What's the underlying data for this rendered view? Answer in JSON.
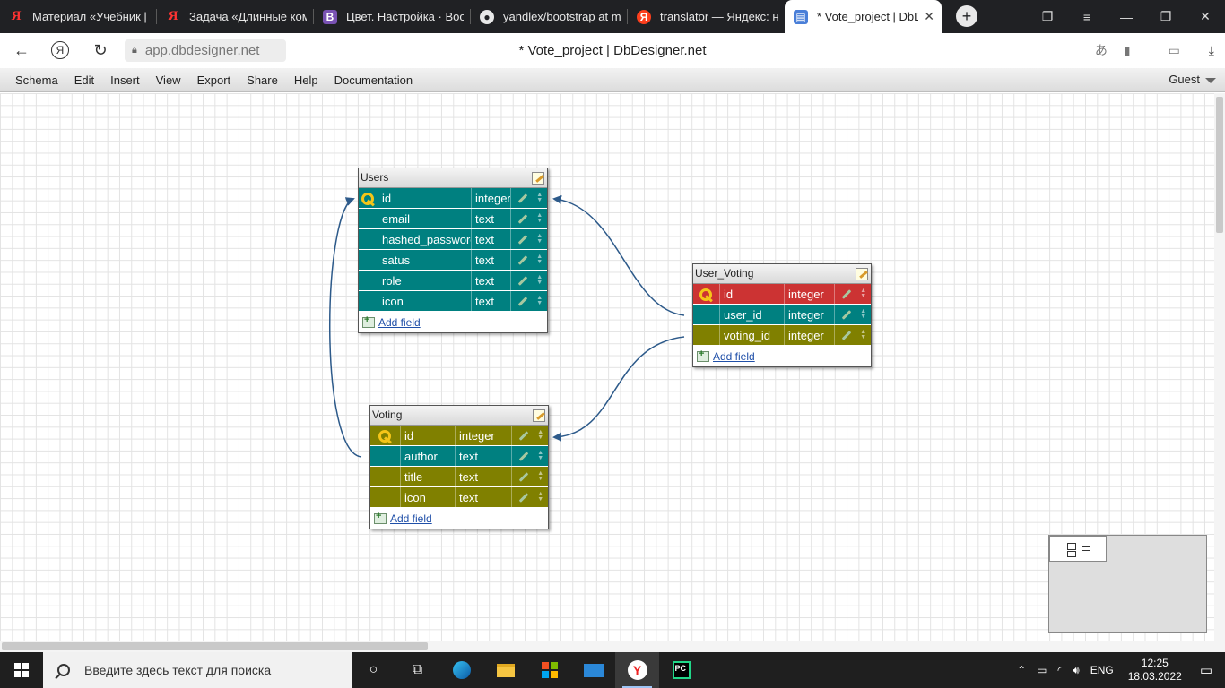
{
  "browser": {
    "tabs": [
      {
        "title": "Материал «Учебник |",
        "icon": "yandex-icon"
      },
      {
        "title": "Задача «Длинные ком",
        "icon": "yandex-icon"
      },
      {
        "title": "Цвет. Настройка · Boo",
        "icon": "bootstrap-icon"
      },
      {
        "title": "yandlex/bootstrap at m",
        "icon": "github-icon"
      },
      {
        "title": "translator — Яндекс: н",
        "icon": "yandex-translate-icon"
      },
      {
        "title": "* Vote_project | DbD",
        "icon": "dbdesigner-icon",
        "active": true
      }
    ],
    "url": "app.dbdesigner.net",
    "page_title": "* Vote_project | DbDesigner.net"
  },
  "menubar": {
    "items": [
      "Schema",
      "Edit",
      "Insert",
      "View",
      "Export",
      "Share",
      "Help",
      "Documentation"
    ],
    "user": "Guest"
  },
  "tables": {
    "users": {
      "name": "Users",
      "fields": [
        {
          "name": "id",
          "type": "integer",
          "pk": true
        },
        {
          "name": "email",
          "type": "text"
        },
        {
          "name": "hashed_password",
          "type": "text"
        },
        {
          "name": "satus",
          "type": "text"
        },
        {
          "name": "role",
          "type": "text"
        },
        {
          "name": "icon",
          "type": "text"
        }
      ],
      "add_field": "Add field"
    },
    "user_voting": {
      "name": "User_Voting",
      "fields": [
        {
          "name": "id",
          "type": "integer",
          "pk": true
        },
        {
          "name": "user_id",
          "type": "integer"
        },
        {
          "name": "voting_id",
          "type": "integer"
        }
      ],
      "add_field": "Add field"
    },
    "voting": {
      "name": "Voting",
      "fields": [
        {
          "name": "id",
          "type": "integer",
          "pk": true
        },
        {
          "name": "author",
          "type": "text"
        },
        {
          "name": "title",
          "type": "text"
        },
        {
          "name": "icon",
          "type": "text"
        }
      ],
      "add_field": "Add field"
    }
  },
  "colors": {
    "teal": "#008080",
    "olive": "#808000",
    "red": "#cc3333",
    "link": "#2d5a8a"
  },
  "taskbar": {
    "search_placeholder": "Введите здесь текст для поиска",
    "language": "ENG",
    "time": "12:25",
    "date": "18.03.2022"
  }
}
